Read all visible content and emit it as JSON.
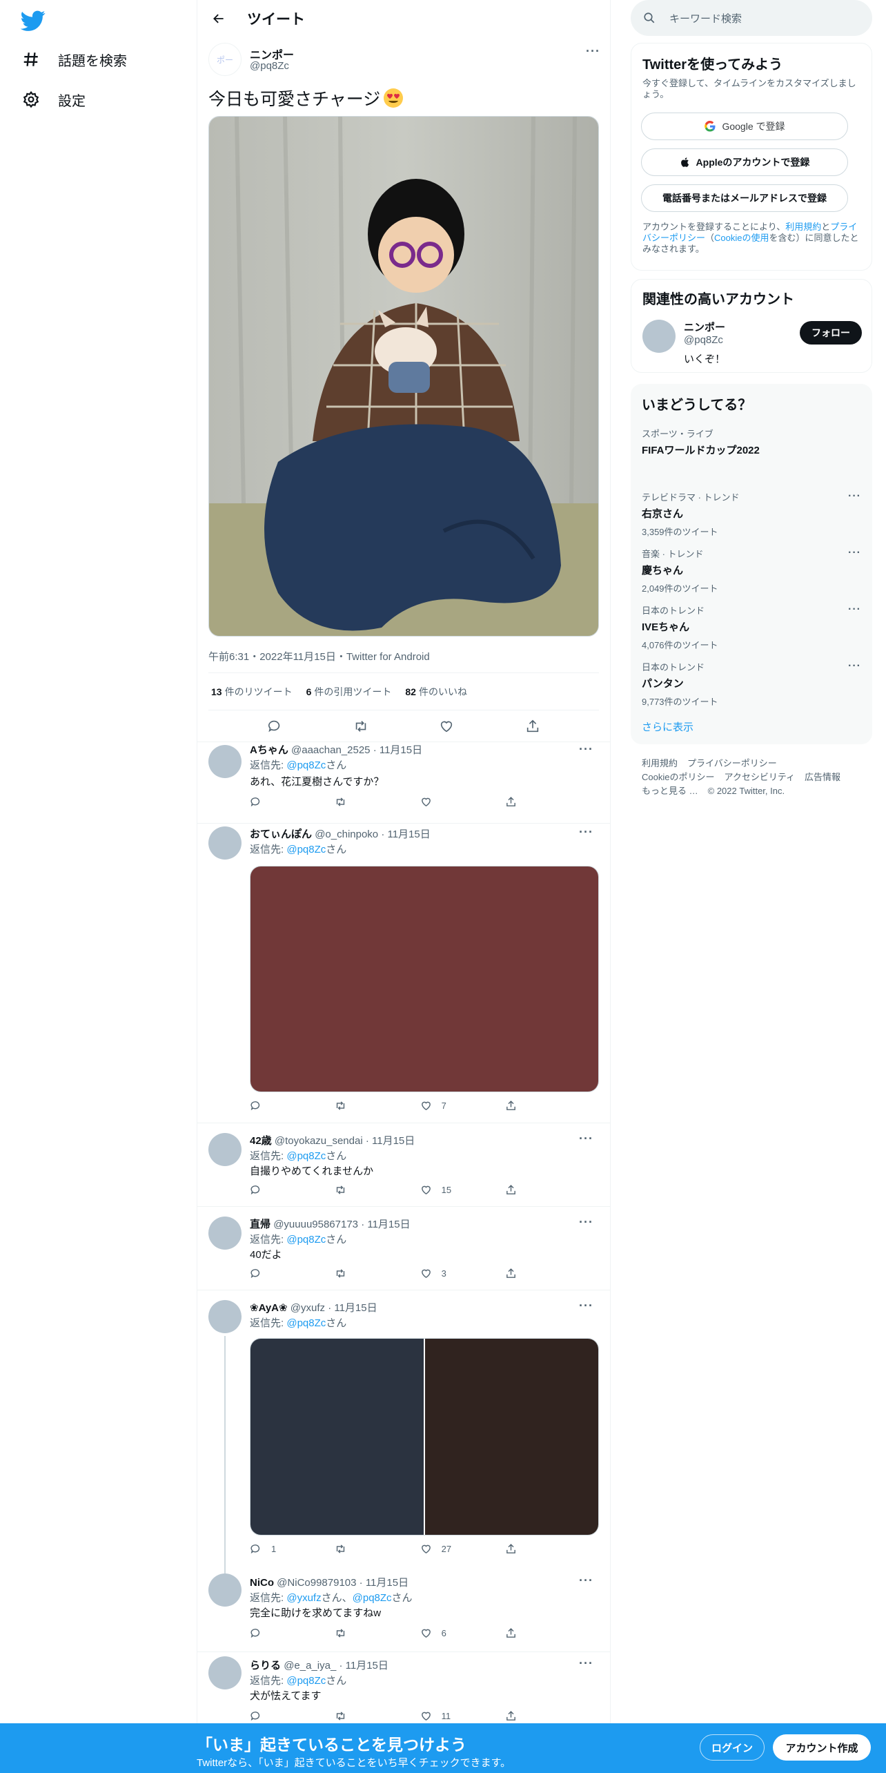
{
  "nav": {
    "explore_label": "話題を検索",
    "settings_label": "設定"
  },
  "header": {
    "title": "ツイート"
  },
  "tweet": {
    "name": "ニンポー",
    "handle": "@pq8Zc",
    "avatar_text": "ポー",
    "text": "今日も可愛さチャージ",
    "meta": "午前6:31・2022年11月15日・Twitter for Android",
    "stats": [
      {
        "count": "13",
        "label": "件のリツイート"
      },
      {
        "count": "6",
        "label": "件の引用ツイート"
      },
      {
        "count": "82",
        "label": "件のいいね"
      }
    ]
  },
  "reply_prefix": "返信先: ",
  "reply_suffix": "さん",
  "replies": [
    {
      "name": "Aちゃん",
      "handle": "@aaachan_2525",
      "date": "· 11月15日",
      "to": "@pq8Zc",
      "text": "あれ、花江夏樹さんですか？",
      "likes": ""
    },
    {
      "name": "おてぃんぽん",
      "handle": "@o_chinpoko",
      "date": "· 11月15日",
      "to": "@pq8Zc",
      "text": "",
      "likes": "7"
    },
    {
      "name": "42歳",
      "handle": "@toyokazu_sendai",
      "date": "· 11月15日",
      "to": "@pq8Zc",
      "text": "自撮りやめてくれませんか",
      "likes": "15"
    },
    {
      "name": "直帰",
      "handle": "@yuuuu95867173",
      "date": "· 11月15日",
      "to": "@pq8Zc",
      "text": "40だよ",
      "likes": "3"
    },
    {
      "name": "❀AyA❀",
      "handle": "@yxufz",
      "date": "· 11月15日",
      "to": "@pq8Zc",
      "text": "",
      "likes": "27",
      "replies_count": "1"
    },
    {
      "name": "NiCo",
      "handle": "@NiCo99879103",
      "date": "· 11月15日",
      "to": "@yxufz",
      "to2": "@pq8Zc",
      "text": "完全に助けを求めてますねw",
      "likes": "6"
    },
    {
      "name": "らりる",
      "handle": "@e_a_iya_",
      "date": "· 11月15日",
      "to": "@pq8Zc",
      "text": "犬が怯えてます",
      "likes": "11"
    }
  ],
  "reply_media_colors": {
    "r2": "#713838",
    "r5a": "#2b3340",
    "r5b": "#30231f"
  },
  "right": {
    "search_placeholder": "キーワード検索",
    "signup": {
      "title": "Twitterを使ってみよう",
      "subtitle": "今すぐ登録して、タイムラインをカスタマイズしましょう。",
      "google": "Google で登録",
      "apple": "Appleのアカウントで登録",
      "phone": "電話番号またはメールアドレスで登録",
      "terms_a": "アカウントを登録することにより、",
      "terms_link1": "利用規約",
      "terms_b": "と",
      "terms_link2": "プライバシーポリシー",
      "terms_c": "（",
      "terms_link3": "Cookieの使用",
      "terms_d": "を含む）に同意したとみなされます。"
    },
    "related": {
      "title": "関連性の高いアカウント",
      "name": "ニンポー",
      "handle": "@pq8Zc",
      "bio": "いくぞ！",
      "follow": "フォロー"
    },
    "trends": {
      "title": "いまどうしてる？",
      "items": [
        {
          "cat": "スポーツ・ライブ",
          "title": "FIFAワールドカップ2022",
          "count": ""
        },
        {
          "cat": "テレビドラマ · トレンド",
          "title": "右京さん",
          "count": "3,359件のツイート"
        },
        {
          "cat": "音楽 · トレンド",
          "title": "慶ちゃん",
          "count": "2,049件のツイート"
        },
        {
          "cat": "日本のトレンド",
          "title": "IVEちゃん",
          "count": "4,076件のツイート"
        },
        {
          "cat": "日本のトレンド",
          "title": "パンタン",
          "count": "9,773件のツイート"
        }
      ],
      "show_more": "さらに表示"
    },
    "footer": [
      "利用規約",
      "プライバシーポリシー",
      "Cookieのポリシー",
      "アクセシビリティ",
      "広告情報",
      "もっと見る …",
      "© 2022 Twitter, Inc."
    ]
  },
  "bottom": {
    "title": "「いま」起きていることを見つけよう",
    "subtitle": "Twitterなら、「いま」起きていることをいち早くチェックできます。",
    "login": "ログイン",
    "signup": "アカウント作成"
  }
}
